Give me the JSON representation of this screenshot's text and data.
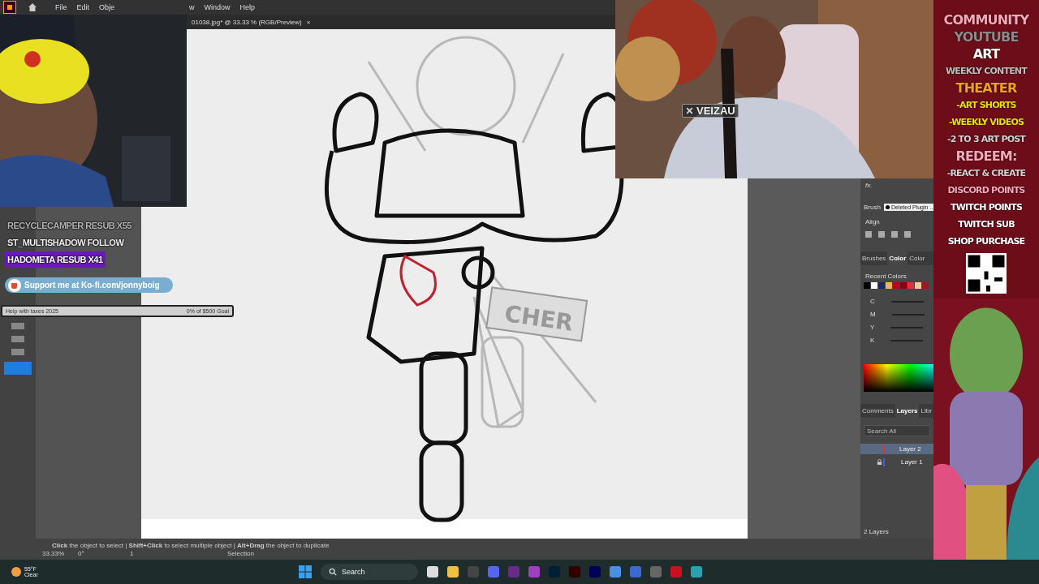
{
  "menubar": {
    "items": [
      "File",
      "Edit",
      "Obje",
      "w",
      "Window",
      "Help"
    ]
  },
  "document_tab": {
    "title": "01038.jpg* @ 33.33 % (RGB/Preview)",
    "close": "×"
  },
  "alerts": [
    {
      "text": "RECYCLECAMPER  RESUB X55",
      "kind": "faded"
    },
    {
      "text": "ST_MULTISHADOW  FOLLOW",
      "kind": "plain"
    },
    {
      "text": "HADOMETA  RESUB X41",
      "kind": "highlight"
    }
  ],
  "kofi_banner": {
    "text": "Support me at Ko-fi.com/jonnyboig"
  },
  "goal": {
    "title": "Help with taxes 2025",
    "reading": "0% of $500 Goal",
    "level": 0
  },
  "webcam": {
    "name": "VEIZAU"
  },
  "canvas": {
    "sign_text": "CHER"
  },
  "right_panel": {
    "fx": "fx.",
    "brush_label": "Brush",
    "brush_value": "Deleted Plugin ...",
    "align_label": "Align",
    "tabs": [
      {
        "label": "Brushes",
        "selected": false
      },
      {
        "label": "Color",
        "selected": true
      },
      {
        "label": "Color",
        "selected": false
      }
    ],
    "recent_colors_label": "Recent Colors",
    "recent_colors": [
      {
        "color": "#000000"
      },
      {
        "color": "#ffffff"
      },
      {
        "color": "#1c2a5e"
      },
      {
        "color": "#f0b84a"
      },
      {
        "color": "#c0001a"
      },
      {
        "color": "#8b0010"
      },
      {
        "color": "#e0303a"
      },
      {
        "color": "#f5c89a"
      },
      {
        "color": "#a01828"
      }
    ],
    "channels": [
      "C",
      "M",
      "Y",
      "K"
    ],
    "bottom_tabs": [
      {
        "label": "Comments",
        "selected": false
      },
      {
        "label": "Layers",
        "selected": true
      },
      {
        "label": "Libr",
        "selected": false
      }
    ],
    "search": {
      "placeholder": "Search All"
    },
    "layers": [
      {
        "name": "Layer 2",
        "selected": true,
        "locked": false,
        "color": "#e03040"
      },
      {
        "name": "Layer 1",
        "selected": false,
        "locked": true,
        "color": "#4060d0"
      }
    ],
    "layer_count": "2 Layers"
  },
  "status_bar": {
    "hint": "**Click** the object to select | **Shift+Click** to select multiple object | **Alt+Drag** the object to duplicate",
    "zoom": "33.33%",
    "angle": "0°",
    "artboard": "1",
    "tool": "Selection"
  },
  "overlay_panel": [
    {
      "text": "COMMUNITY",
      "color": "#f4a8b8",
      "kind": "big"
    },
    {
      "text": "YOUTUBE",
      "color": "#8a8a8a",
      "kind": "big"
    },
    {
      "text": "ART",
      "color": "#ffffff",
      "kind": "big"
    },
    {
      "text": "WEEKLY CONTENT",
      "color": "#bdbdbd",
      "kind": "small"
    },
    {
      "text": "THEATER",
      "color": "#f0a020",
      "kind": "big"
    },
    {
      "text": "-ART SHORTS",
      "color": "#e8e000",
      "kind": "small"
    },
    {
      "text": "-WEEKLY VIDEOS",
      "color": "#e8e000",
      "kind": "small"
    },
    {
      "text": "-2 TO 3 ART POST",
      "color": "#d0d0d0",
      "kind": "small"
    },
    {
      "text": "REDEEM:",
      "color": "#f4a8b8",
      "kind": "big"
    },
    {
      "text": "-REACT & CREATE",
      "color": "#d0d0d0",
      "kind": "small"
    },
    {
      "text": "DISCORD POINTS",
      "color": "#f4a8b8",
      "kind": "small"
    },
    {
      "text": "TWITCH POINTS",
      "color": "#ffffff",
      "kind": "small"
    },
    {
      "text": "TWITCH SUB",
      "color": "#ffffff",
      "kind": "small"
    },
    {
      "text": "SHOP PURCHASE",
      "color": "#ffffff",
      "kind": "small"
    }
  ],
  "taskbar": {
    "temperature": "55°F",
    "condition": "Clear",
    "search": "Search"
  }
}
